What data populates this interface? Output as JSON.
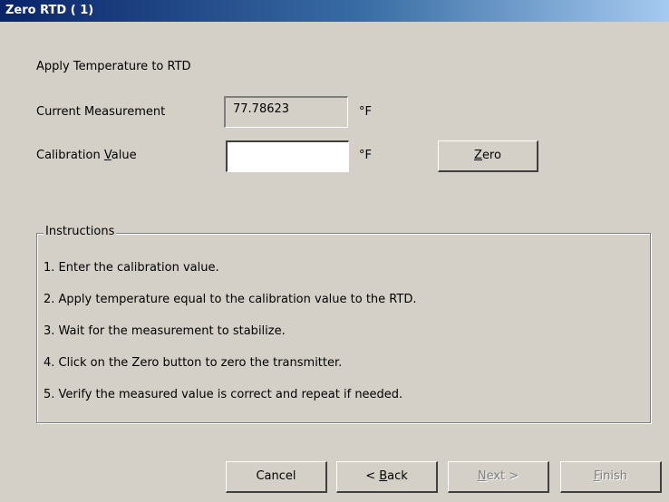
{
  "window": {
    "title": "Zero RTD ( 1)"
  },
  "form": {
    "heading": "Apply Temperature to RTD",
    "current_measurement_label": "Current Measurement",
    "current_measurement_value": "77.78623",
    "unit1": "°F",
    "calibration_label_pre": "Calibration ",
    "calibration_label_mnemonic": "V",
    "calibration_label_post": "alue",
    "calibration_value": "",
    "unit2": "°F",
    "zero_button_mnemonic": "Z",
    "zero_button_rest": "ero"
  },
  "instructions": {
    "title": "Instructions",
    "items": [
      "1. Enter the calibration value.",
      "2. Apply temperature equal to the calibration value to the RTD.",
      "3. Wait for the measurement to stabilize.",
      "4. Click on the Zero button to zero the transmitter.",
      "5. Verify the measured value is correct and repeat if needed."
    ]
  },
  "footer": {
    "cancel_label": "Cancel",
    "back_pre": "< ",
    "back_mnemonic": "B",
    "back_rest": "ack",
    "next_mnemonic": "N",
    "next_rest": "ext >",
    "finish_mnemonic": "F",
    "finish_rest": "inish",
    "next_enabled": false,
    "finish_enabled": false
  },
  "colors": {
    "dialog_bg": "#d4d0c8",
    "title_gradient_start": "#0a246a",
    "title_gradient_end": "#a6caf0",
    "disabled_text": "#808080"
  }
}
